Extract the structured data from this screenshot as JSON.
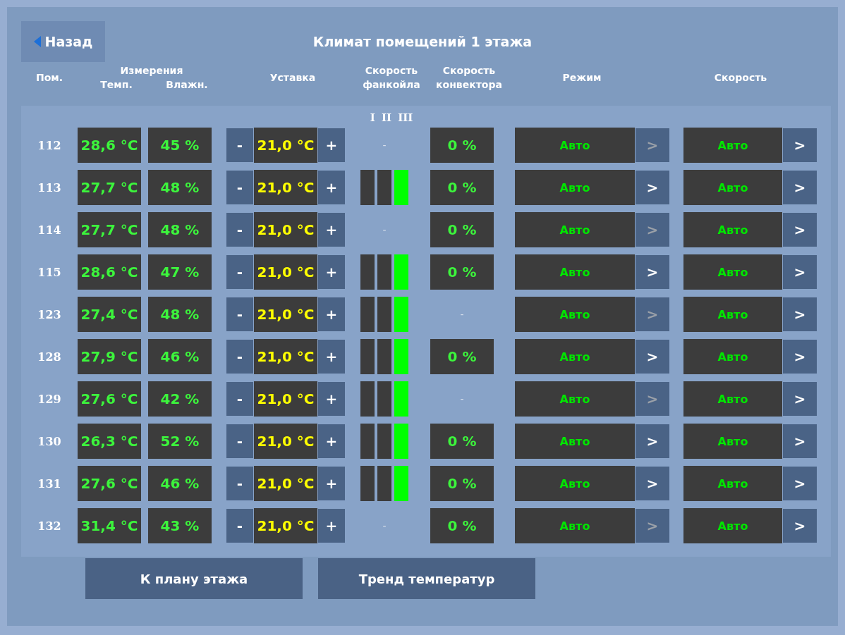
{
  "back_button": {
    "label": "Назад"
  },
  "title": "Климат помещений 1 этажа",
  "headers": {
    "room": "Пом.",
    "measurements": "Измерения",
    "temp": "Темп.",
    "humidity": "Влажн.",
    "setpoint": "Уставка",
    "fancoil": [
      "Скорость",
      "фанкойла"
    ],
    "convector": [
      "Скорость",
      "конвектора"
    ],
    "mode": "Режим",
    "speed": "Скорость",
    "fan_stages": [
      "I",
      "II",
      "III"
    ]
  },
  "rows": [
    {
      "room": "112",
      "temp": "28,6 °C",
      "humidity": "45 %",
      "setpoint": "21,0 °C",
      "fancoil": {
        "kind": "none",
        "text": "-"
      },
      "convector": {
        "kind": "value",
        "text": "0 %"
      },
      "mode": "Авто",
      "mode_arrow_disabled": true,
      "speed": "Авто"
    },
    {
      "room": "113",
      "temp": "27,7 °C",
      "humidity": "48 %",
      "setpoint": "21,0 °C",
      "fancoil": {
        "kind": "bars",
        "stages": [
          false,
          false,
          true
        ]
      },
      "convector": {
        "kind": "value",
        "text": "0 %"
      },
      "mode": "Авто",
      "mode_arrow_disabled": false,
      "speed": "Авто"
    },
    {
      "room": "114",
      "temp": "27,7 °C",
      "humidity": "48 %",
      "setpoint": "21,0 °C",
      "fancoil": {
        "kind": "none",
        "text": "-"
      },
      "convector": {
        "kind": "value",
        "text": "0 %"
      },
      "mode": "Авто",
      "mode_arrow_disabled": true,
      "speed": "Авто"
    },
    {
      "room": "115",
      "temp": "28,6 °C",
      "humidity": "47 %",
      "setpoint": "21,0 °C",
      "fancoil": {
        "kind": "bars",
        "stages": [
          false,
          false,
          true
        ]
      },
      "convector": {
        "kind": "value",
        "text": "0 %"
      },
      "mode": "Авто",
      "mode_arrow_disabled": false,
      "speed": "Авто"
    },
    {
      "room": "123",
      "temp": "27,4 °C",
      "humidity": "48 %",
      "setpoint": "21,0 °C",
      "fancoil": {
        "kind": "bars",
        "stages": [
          false,
          false,
          true
        ]
      },
      "convector": {
        "kind": "none",
        "text": "-"
      },
      "mode": "Авто",
      "mode_arrow_disabled": true,
      "speed": "Авто"
    },
    {
      "room": "128",
      "temp": "27,9 °C",
      "humidity": "46 %",
      "setpoint": "21,0 °C",
      "fancoil": {
        "kind": "bars",
        "stages": [
          false,
          false,
          true
        ]
      },
      "convector": {
        "kind": "value",
        "text": "0 %"
      },
      "mode": "Авто",
      "mode_arrow_disabled": false,
      "speed": "Авто"
    },
    {
      "room": "129",
      "temp": "27,6 °C",
      "humidity": "42 %",
      "setpoint": "21,0 °C",
      "fancoil": {
        "kind": "bars",
        "stages": [
          false,
          false,
          true
        ]
      },
      "convector": {
        "kind": "none",
        "text": "-"
      },
      "mode": "Авто",
      "mode_arrow_disabled": true,
      "speed": "Авто"
    },
    {
      "room": "130",
      "temp": "26,3 °C",
      "humidity": "52 %",
      "setpoint": "21,0 °C",
      "fancoil": {
        "kind": "bars",
        "stages": [
          false,
          false,
          true
        ]
      },
      "convector": {
        "kind": "value",
        "text": "0 %"
      },
      "mode": "Авто",
      "mode_arrow_disabled": false,
      "speed": "Авто"
    },
    {
      "room": "131",
      "temp": "27,6 °C",
      "humidity": "46 %",
      "setpoint": "21,0 °C",
      "fancoil": {
        "kind": "bars",
        "stages": [
          false,
          false,
          true
        ]
      },
      "convector": {
        "kind": "value",
        "text": "0 %"
      },
      "mode": "Авто",
      "mode_arrow_disabled": false,
      "speed": "Авто"
    },
    {
      "room": "132",
      "temp": "31,4 °C",
      "humidity": "43 %",
      "setpoint": "21,0 °C",
      "fancoil": {
        "kind": "none",
        "text": "-"
      },
      "convector": {
        "kind": "value",
        "text": "0 %"
      },
      "mode": "Авто",
      "mode_arrow_disabled": true,
      "speed": "Авто"
    }
  ],
  "controls": {
    "minus": "-",
    "plus": "+",
    "arrow": ">"
  },
  "footer_buttons": [
    "К плану этажа",
    "Тренд температур"
  ]
}
